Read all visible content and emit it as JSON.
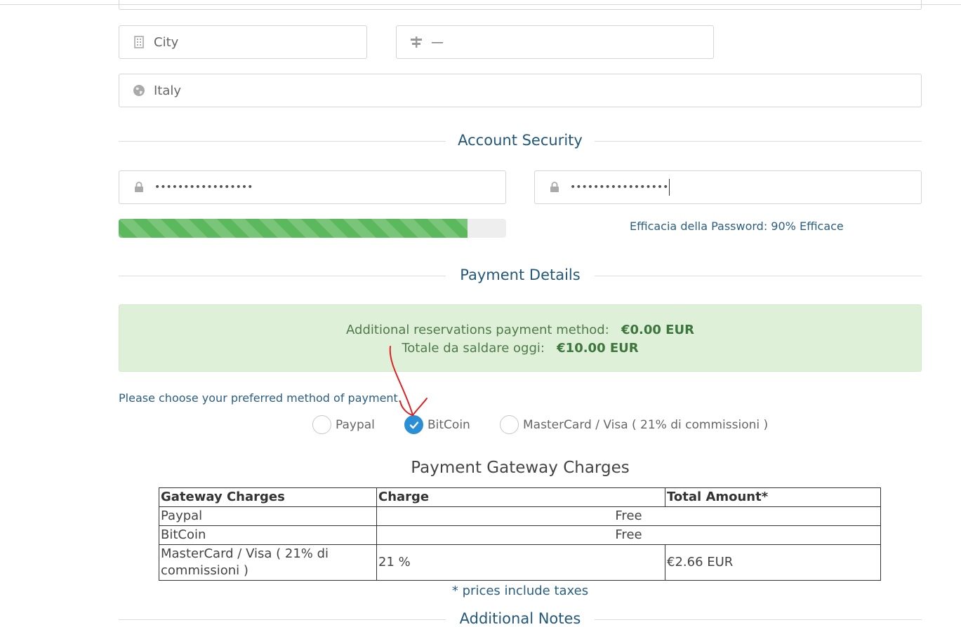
{
  "address": {
    "city": {
      "value": "City",
      "icon": "building-icon"
    },
    "state": {
      "value": "—",
      "icon": "signpost-icon"
    },
    "country": {
      "value": "Italy",
      "icon": "globe-icon"
    }
  },
  "account_security": {
    "title": "Account Security",
    "password": {
      "value": "•••••••••••••••••",
      "icon": "lock-icon"
    },
    "password_confirm": {
      "value": "•••••••••••••••••",
      "icon": "lock-icon"
    },
    "strength_percent": 90,
    "strength_text": "Efficacia della Password: 90% Efficace",
    "strength_color": "#5cb85c"
  },
  "payment_details": {
    "title": "Payment Details",
    "summary": {
      "line1_label": "Additional reservations payment method:",
      "line1_value": "€0.00 EUR",
      "line2_label": "Totale da saldare oggi:",
      "line2_value": "€10.00 EUR",
      "bg_color": "#dff0d8"
    },
    "choose_label": "Please choose your preferred method of payment.",
    "methods": [
      {
        "label": "Paypal",
        "checked": false
      },
      {
        "label": "BitCoin",
        "checked": true
      },
      {
        "label": "MasterCard / Visa ( 21% di commissioni )",
        "checked": false
      }
    ],
    "accent_color": "#2b8fd6"
  },
  "gateway_charges": {
    "title": "Payment Gateway Charges",
    "headers": [
      "Gateway Charges",
      "Charge",
      "Total Amount*"
    ],
    "rows": [
      {
        "gateway": "Paypal",
        "charge": "Free"
      },
      {
        "gateway": "BitCoin",
        "charge": "Free"
      },
      {
        "gateway": "MasterCard / Visa ( 21% di commissioni )",
        "charge": "21 %",
        "total": "€2.66 EUR"
      }
    ],
    "footnote": "* prices include taxes"
  },
  "additional_notes": {
    "title": "Additional Notes"
  }
}
